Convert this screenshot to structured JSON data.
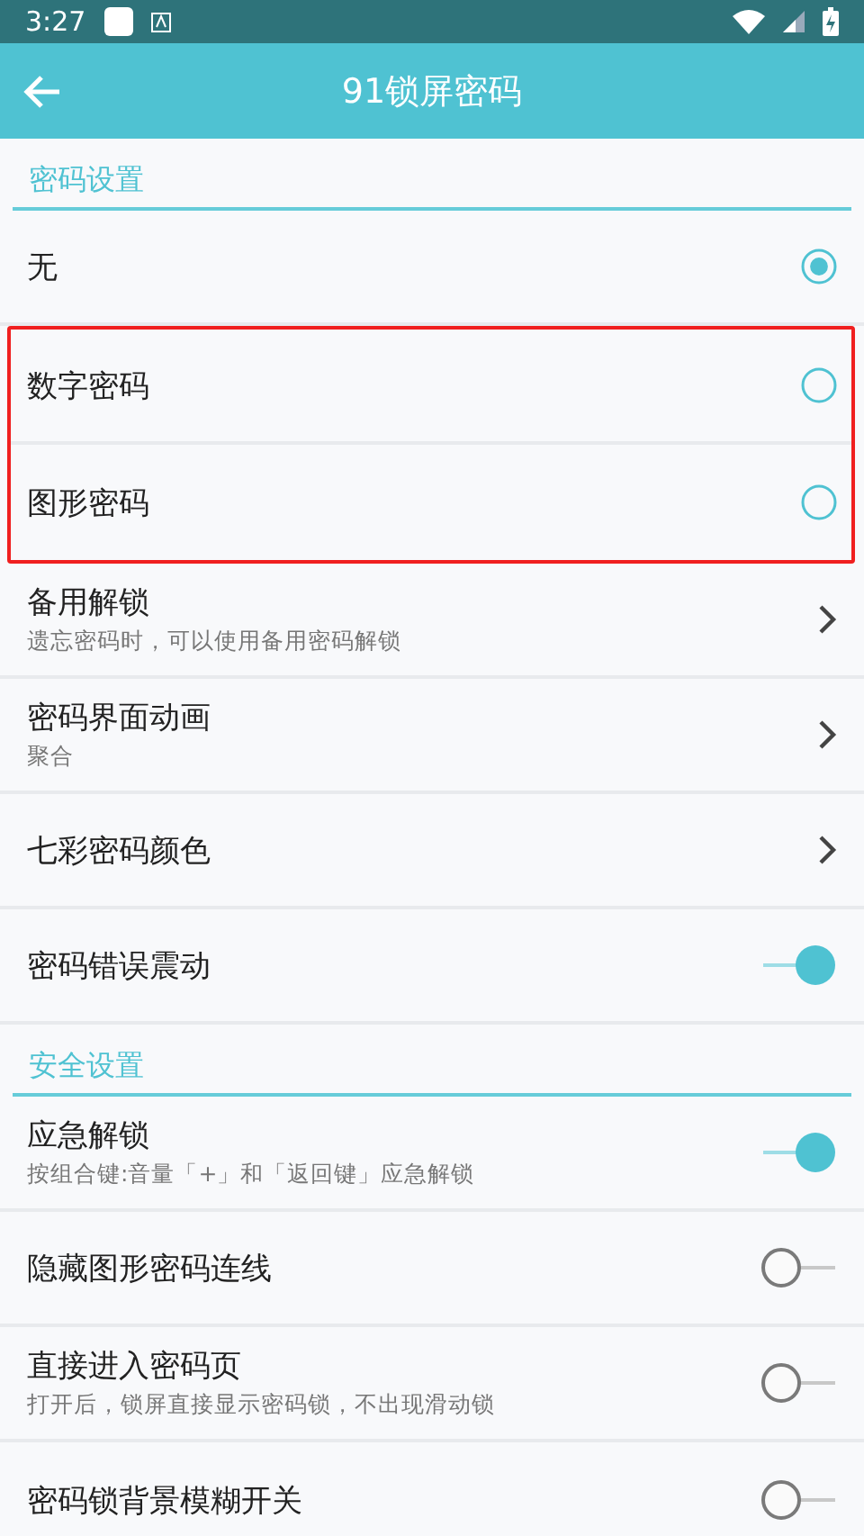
{
  "status_bar": {
    "time": "3:27"
  },
  "app_bar": {
    "title": "91锁屏密码"
  },
  "sections": [
    {
      "title": "密码设置",
      "items": [
        {
          "kind": "radio",
          "title": "无",
          "selected": true,
          "highlighted": false
        },
        {
          "kind": "radio",
          "title": "数字密码",
          "selected": false,
          "highlighted": true
        },
        {
          "kind": "radio",
          "title": "图形密码",
          "selected": false,
          "highlighted": true
        },
        {
          "kind": "link",
          "title": "备用解锁",
          "subtitle": "遗忘密码时，可以使用备用密码解锁",
          "highlighted": false
        },
        {
          "kind": "link",
          "title": "密码界面动画",
          "subtitle": "聚合",
          "highlighted": false
        },
        {
          "kind": "link",
          "title": "七彩密码颜色",
          "highlighted": false
        },
        {
          "kind": "toggle",
          "title": "密码错误震动",
          "on": true,
          "highlighted": false
        }
      ]
    },
    {
      "title": "安全设置",
      "items": [
        {
          "kind": "toggle",
          "title": "应急解锁",
          "subtitle": "按组合键:音量「+」和「返回键」应急解锁",
          "on": true,
          "highlighted": false
        },
        {
          "kind": "toggle",
          "title": "隐藏图形密码连线",
          "on": false,
          "highlighted": false
        },
        {
          "kind": "toggle",
          "title": "直接进入密码页",
          "subtitle": "打开后，锁屏直接显示密码锁，不出现滑动锁",
          "on": false,
          "highlighted": false
        },
        {
          "kind": "toggle",
          "title": "密码锁背景模糊开关",
          "on": false,
          "highlighted": false
        }
      ]
    }
  ]
}
